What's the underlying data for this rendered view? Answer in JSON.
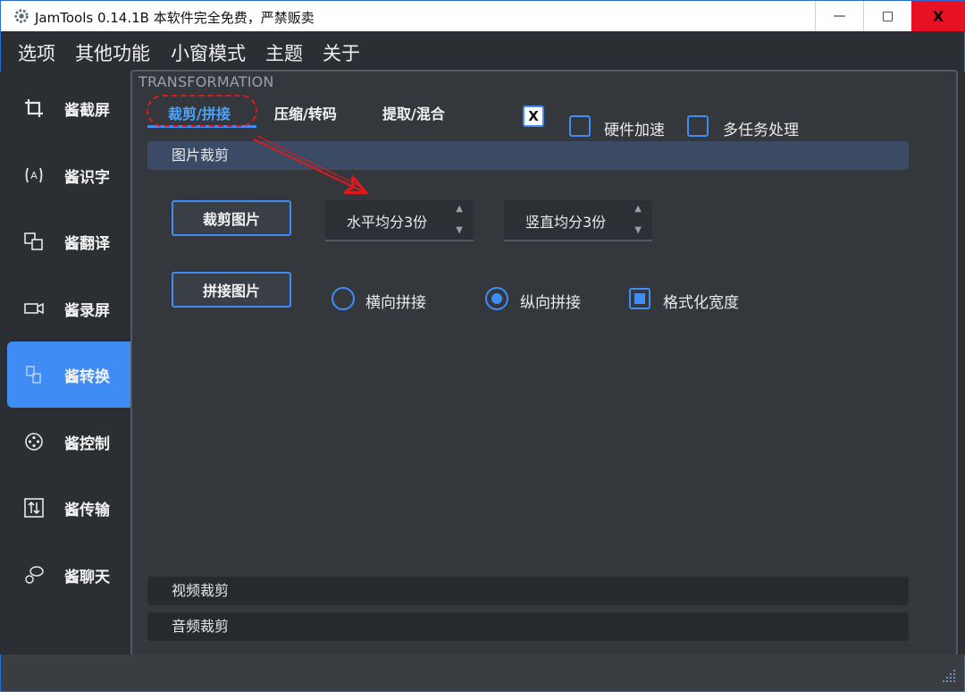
{
  "window": {
    "title": "JamTools 0.14.1B 本软件完全免费，严禁贩卖",
    "minimize_glyph": "—",
    "maximize_glyph": "□",
    "close_glyph": "X"
  },
  "menu": [
    "选项",
    "其他功能",
    "小窗模式",
    "主题",
    "关于"
  ],
  "sidebar": {
    "items": [
      {
        "label": "酱截屏",
        "icon": "crop-icon"
      },
      {
        "label": "酱识字",
        "icon": "ocr-icon"
      },
      {
        "label": "酱翻译",
        "icon": "translate-icon"
      },
      {
        "label": "酱录屏",
        "icon": "camera-icon"
      },
      {
        "label": "酱转换",
        "icon": "convert-icon",
        "active": true
      },
      {
        "label": "酱控制",
        "icon": "control-icon"
      },
      {
        "label": "酱传输",
        "icon": "transfer-icon"
      },
      {
        "label": "酱聊天",
        "icon": "chat-icon"
      }
    ]
  },
  "panel": {
    "title": "TRANSFORMATION",
    "tabs": [
      "裁剪/拼接",
      "压缩/转码",
      "提取/混合"
    ],
    "active_tab": "裁剪/拼接",
    "close_checkbox": "X",
    "options": [
      {
        "label": "硬件加速",
        "checked": false
      },
      {
        "label": "多任务处理",
        "checked": false
      }
    ],
    "sections": {
      "image_crop": "图片裁剪",
      "video_crop": "视频裁剪",
      "audio_crop": "音频裁剪"
    },
    "crop_button": "裁剪图片",
    "stitch_button": "拼接图片",
    "spin_horizontal": "水平均分3份",
    "spin_vertical": "竖直均分3份",
    "stitch_options": [
      {
        "label": "横向拼接",
        "checked": false
      },
      {
        "label": "纵向拼接",
        "checked": true
      }
    ],
    "format_width": {
      "label": "格式化宽度",
      "checked": true
    }
  },
  "colors": {
    "accent": "#3f8cf5",
    "annotation": "#e01a1a",
    "background": "#2b2e33",
    "panel": "#34383d"
  }
}
